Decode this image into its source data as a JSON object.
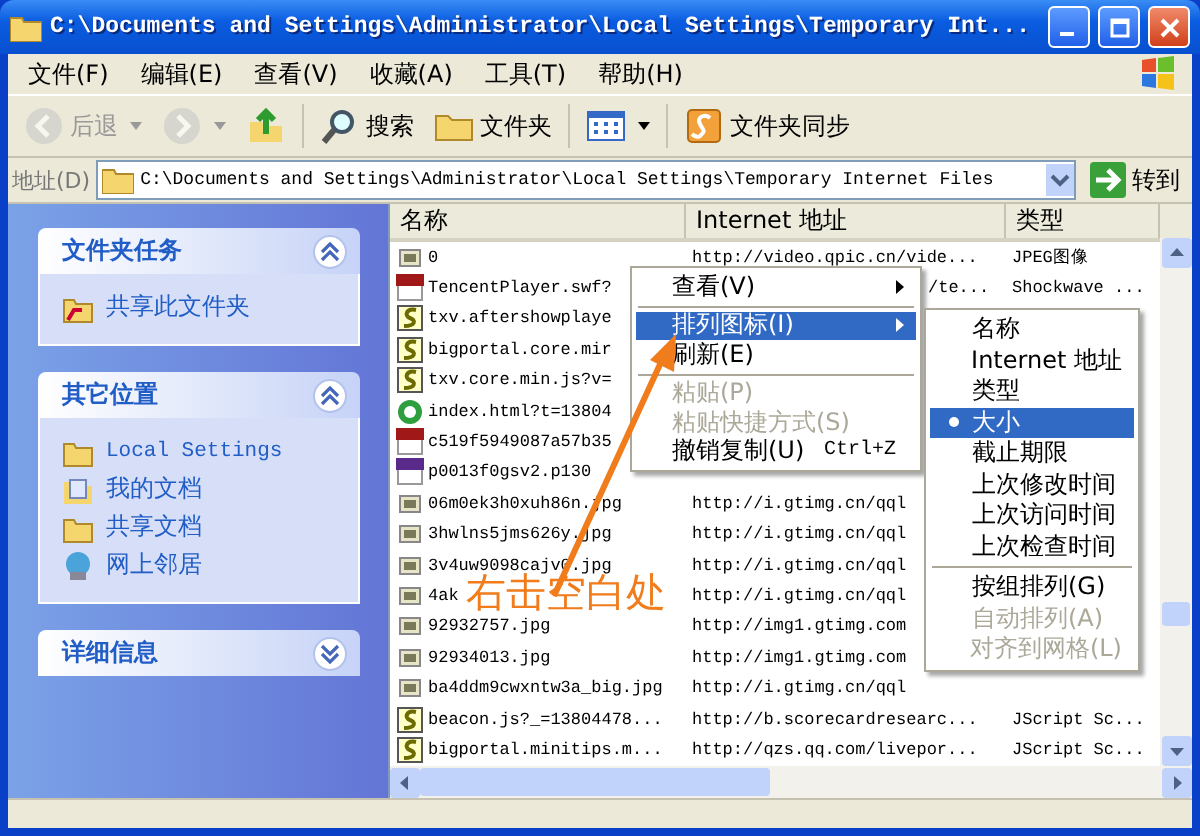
{
  "window": {
    "title": "C:\\Documents and Settings\\Administrator\\Local Settings\\Temporary Int..."
  },
  "menu": [
    "文件(F)",
    "编辑(E)",
    "查看(V)",
    "收藏(A)",
    "工具(T)",
    "帮助(H)"
  ],
  "toolbar": [
    {
      "kind": "back",
      "label": "后退",
      "disabled": true,
      "dropdown": true
    },
    {
      "kind": "forward",
      "disabled": true,
      "dropdown": true
    },
    {
      "kind": "up",
      "disabled": false,
      "dropdown": false
    },
    {
      "kind": "search",
      "label": "搜索",
      "disabled": false,
      "dropdown": false
    },
    {
      "kind": "folders",
      "label": "文件夹",
      "disabled": false,
      "dropdown": false
    },
    {
      "kind": "views",
      "disabled": false,
      "dropdown": true
    },
    {
      "kind": "sync",
      "label": "文件夹同步",
      "disabled": false,
      "dropdown": false
    }
  ],
  "address": {
    "label": "地址(D)",
    "value": "C:\\Documents and Settings\\Administrator\\Local Settings\\Temporary Internet Files",
    "go": "转到"
  },
  "sidebar": [
    {
      "title": "文件夹任务",
      "expanded": true,
      "items": [
        {
          "kind": "share",
          "label": "共享此文件夹"
        }
      ]
    },
    {
      "title": "其它位置",
      "expanded": true,
      "items": [
        {
          "kind": "folder",
          "label": "Local Settings"
        },
        {
          "kind": "docs",
          "label": "我的文档"
        },
        {
          "kind": "folder",
          "label": "共享文档"
        },
        {
          "kind": "network",
          "label": "网上邻居"
        }
      ]
    },
    {
      "title": "详细信息",
      "expanded": false
    }
  ],
  "table": {
    "columns": [
      "名称",
      "Internet 地址",
      "类型"
    ],
    "rows": [
      {
        "kind": "image",
        "name": "0",
        "url": "http://video.qpic.cn/vide...",
        "type": "JPEG图像"
      },
      {
        "kind": "flash",
        "name": "TencentPlayer.swf?",
        "url": "/te...",
        "type": "Shockwave ..."
      },
      {
        "kind": "script",
        "name": "txv.aftershowplaye",
        "url": "",
        "type": ""
      },
      {
        "kind": "script",
        "name": "bigportal.core.mir",
        "url": "",
        "type": ""
      },
      {
        "kind": "script",
        "name": "txv.core.min.js?v=",
        "url": "",
        "type": ""
      },
      {
        "kind": "web",
        "name": "index.html?t=13804",
        "url": "",
        "type": ""
      },
      {
        "kind": "flash",
        "name": "c519f5949087a57b35",
        "url": "",
        "type": ""
      },
      {
        "kind": "png",
        "name": "p0013f0gsv2.p130",
        "url": "",
        "type": ""
      },
      {
        "kind": "image",
        "name": "06m0ek3h0xuh86n.jpg",
        "url": "http://i.gtimg.cn/qql",
        "type": ""
      },
      {
        "kind": "image",
        "name": "3hwlns5jms626y.jpg",
        "url": "http://i.gtimg.cn/qql",
        "type": ""
      },
      {
        "kind": "image",
        "name": "3v4uw9098cajv0.jpg",
        "url": "http://i.gtimg.cn/qql",
        "type": ""
      },
      {
        "kind": "image",
        "name": "4ak",
        "url": "http://i.gtimg.cn/qql",
        "type": ""
      },
      {
        "kind": "image",
        "name": "92932757.jpg",
        "url": "http://img1.gtimg.com",
        "type": ""
      },
      {
        "kind": "image",
        "name": "92934013.jpg",
        "url": "http://img1.gtimg.com",
        "type": ""
      },
      {
        "kind": "image",
        "name": "ba4ddm9cwxntw3a_big.jpg",
        "url": "http://i.gtimg.cn/qql",
        "type": ""
      },
      {
        "kind": "script",
        "name": "beacon.js?_=13804478...",
        "url": "http://b.scorecardresearc...",
        "type": "JScript Sc..."
      },
      {
        "kind": "script",
        "name": "bigportal.minitips.m...",
        "url": "http://qzs.qq.com/livepor...",
        "type": "JScript Sc..."
      }
    ]
  },
  "context_menu": [
    {
      "kind": "item",
      "label": "查看(V)",
      "submenu": true,
      "selected": false,
      "disabled": false
    },
    {
      "kind": "separator"
    },
    {
      "kind": "item",
      "label": "排列图标(I)",
      "submenu": true,
      "selected": true,
      "disabled": false
    },
    {
      "kind": "item",
      "label": "刷新(E)",
      "submenu": false,
      "selected": false,
      "disabled": false
    },
    {
      "kind": "separator"
    },
    {
      "kind": "item",
      "label": "粘贴(P)",
      "submenu": false,
      "selected": false,
      "disabled": true
    },
    {
      "kind": "item",
      "label": "粘贴快捷方式(S)",
      "submenu": false,
      "selected": false,
      "disabled": true
    },
    {
      "kind": "item",
      "label": "撤销复制(U)",
      "shortcut": "Ctrl+Z",
      "submenu": false,
      "selected": false,
      "disabled": false
    }
  ],
  "submenu": [
    {
      "kind": "item",
      "label": "名称",
      "checked": false,
      "selected": false,
      "disabled": false
    },
    {
      "kind": "item",
      "label": "Internet 地址",
      "checked": false,
      "selected": false,
      "disabled": false
    },
    {
      "kind": "item",
      "label": "类型",
      "checked": false,
      "selected": false,
      "disabled": false
    },
    {
      "kind": "item",
      "label": "大小",
      "checked": true,
      "selected": true,
      "disabled": false
    },
    {
      "kind": "item",
      "label": "截止期限",
      "checked": false,
      "selected": false,
      "disabled": false
    },
    {
      "kind": "item",
      "label": "上次修改时间",
      "checked": false,
      "selected": false,
      "disabled": false
    },
    {
      "kind": "item",
      "label": "上次访问时间",
      "checked": false,
      "selected": false,
      "disabled": false
    },
    {
      "kind": "item",
      "label": "上次检查时间",
      "checked": false,
      "selected": false,
      "disabled": false
    },
    {
      "kind": "separator"
    },
    {
      "kind": "item",
      "label": "按组排列(G)",
      "checked": false,
      "selected": false,
      "disabled": false
    },
    {
      "kind": "item",
      "label": "自动排列(A)",
      "checked": false,
      "selected": false,
      "disabled": true
    },
    {
      "kind": "item",
      "label": "对齐到网格(L)",
      "checked": false,
      "selected": false,
      "disabled": true
    }
  ],
  "annotation": {
    "text": "右击空白处"
  }
}
